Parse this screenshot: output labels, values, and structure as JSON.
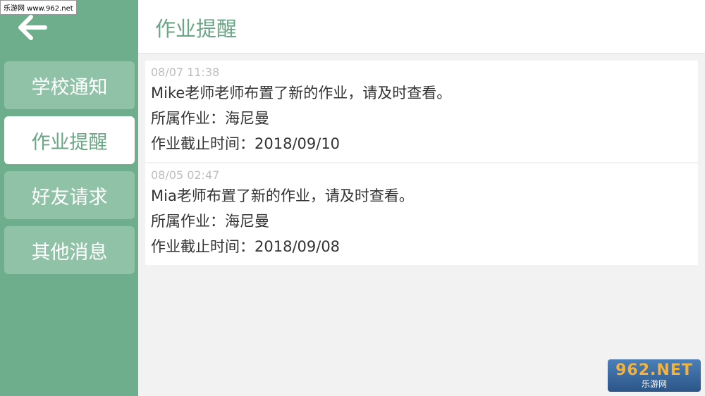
{
  "watermark_top": "乐游网 www.962.net",
  "sidebar": {
    "items": [
      {
        "label": "学校通知"
      },
      {
        "label": "作业提醒"
      },
      {
        "label": "好友请求"
      },
      {
        "label": "其他消息"
      }
    ]
  },
  "header": {
    "title": "作业提醒"
  },
  "notifications": [
    {
      "time": "08/07  11:38",
      "message": "Mike老师老师布置了新的作业，请及时查看。",
      "homework": "所属作业：海尼曼",
      "deadline": "作业截止时间：2018/09/10"
    },
    {
      "time": "08/05  02:47",
      "message": "Mia老师布置了新的作业，请及时查看。",
      "homework": "所属作业：海尼曼",
      "deadline": "作业截止时间：2018/09/08"
    }
  ],
  "watermark_logo": {
    "big": "962.NET",
    "small": "乐游网"
  },
  "colors": {
    "sidebar": "#6fae8c",
    "nav_inactive": "#8fc2a6",
    "accent": "#6aa585"
  }
}
